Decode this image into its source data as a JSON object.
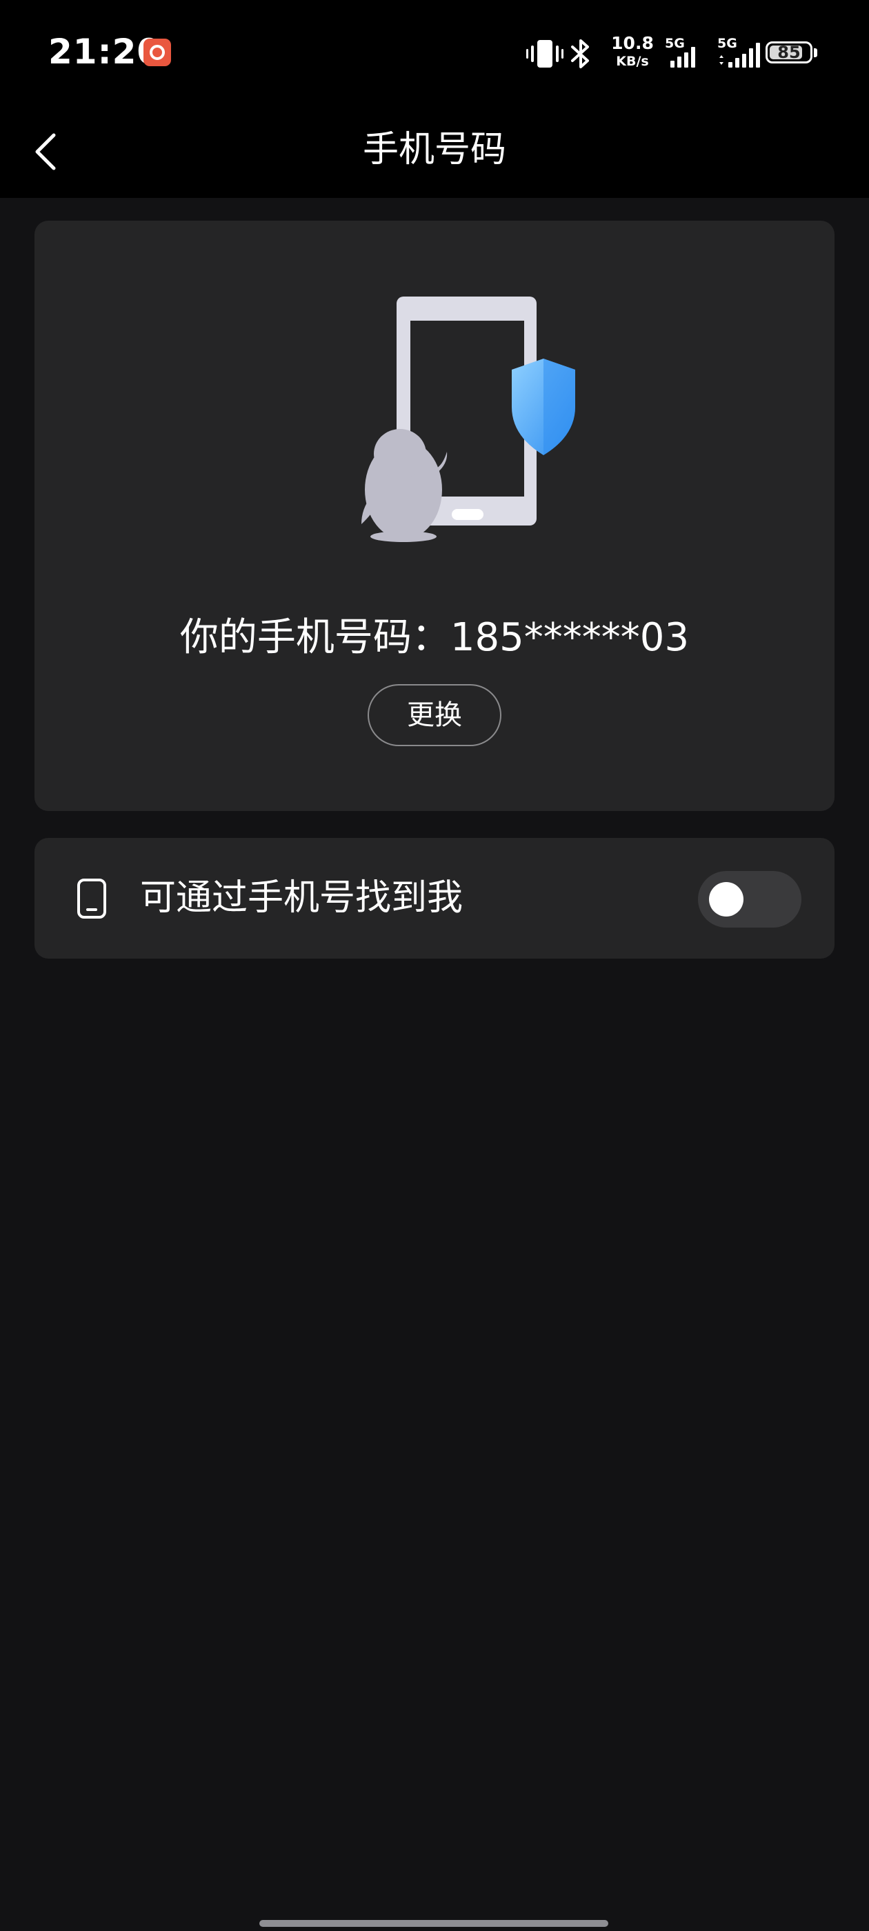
{
  "status_bar": {
    "time": "21:20",
    "notification_icon": "record-app-icon",
    "net_speed_value": "10.8",
    "net_speed_unit": "KB/s",
    "signal1_label": "5G",
    "signal2_label": "5G",
    "battery_percent": "85",
    "battery_level": 0.85
  },
  "nav": {
    "title": "手机号码",
    "back_icon": "chevron-left-icon"
  },
  "phone_card": {
    "phone_text": "你的手机号码：185******03",
    "change_label": "更换",
    "shield_color": "#4aa8f5"
  },
  "find_me": {
    "label": "可通过手机号找到我",
    "toggle_on": false
  },
  "colors": {
    "background": "#121214",
    "card": "#252526",
    "bar": "#000000"
  }
}
